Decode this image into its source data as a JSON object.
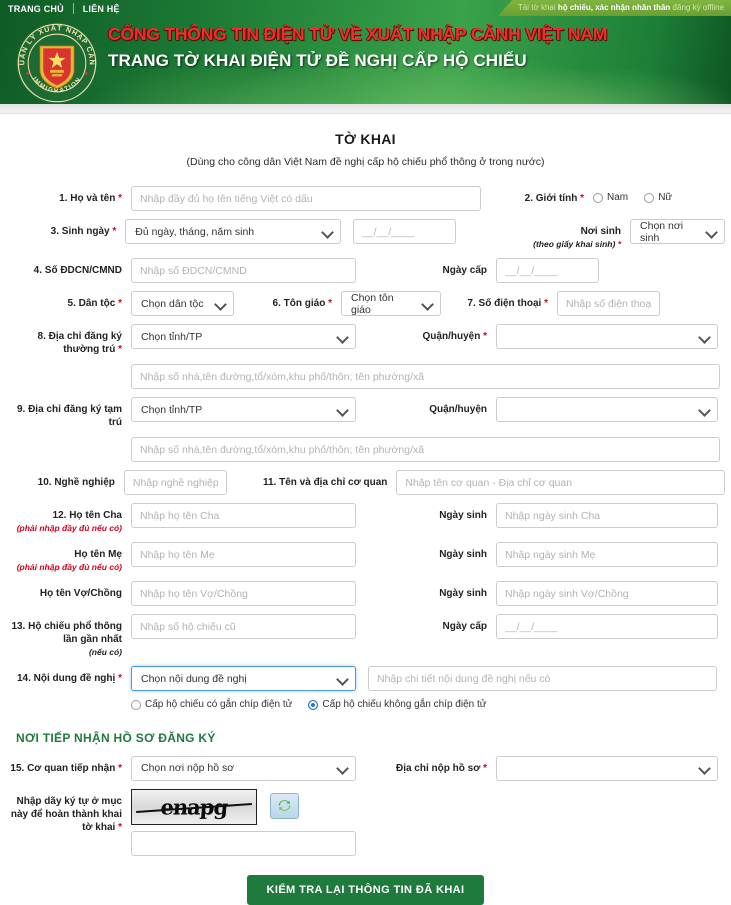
{
  "header": {
    "nav": [
      {
        "label": "TRANG CHỦ"
      },
      {
        "label": "LIÊN HỆ"
      }
    ],
    "notice_pre": "Tải tờ khai ",
    "notice_bold1": "hộ chiếu, xác nhận nhân thân",
    "notice_post": " đăng ký offline",
    "emblem_outer_top": "QUẢN LÝ XUẤT NHẬP CẢNH",
    "emblem_outer_bottom": "IMMIGRATION",
    "title_line1": "CỔNG THÔNG TIN ĐIỆN TỬ VỀ XUẤT NHẬP CẢNH VIỆT NAM",
    "title_line2": "TRANG TỜ KHAI ĐIỆN TỬ ĐỀ NGHỊ CẤP HỘ CHIẾU",
    "colors": {
      "bar_green": "#1d7a36",
      "title_red": "#ef2d2d",
      "notice_green": "#7fb53f"
    }
  },
  "doc": {
    "title": "TỜ KHAI",
    "subtitle": "(Dùng cho công dân Việt Nam đề nghị cấp hộ chiếu phổ thông ở trong nước)"
  },
  "fields": {
    "fullname": {
      "label": "1. Họ và tên",
      "placeholder": "Nhập đầy đủ họ tên tiếng Việt có dấu",
      "value": ""
    },
    "gender": {
      "label": "2. Giới tính",
      "options": [
        {
          "label": "Nam",
          "selected": false
        },
        {
          "label": "Nữ",
          "selected": false
        }
      ]
    },
    "birth": {
      "label": "3. Sinh ngày",
      "select_value": "Đủ ngày, tháng, năm sinh",
      "date_placeholder": "__/__/____",
      "date_value": ""
    },
    "birthplace": {
      "label": "Nơi sinh",
      "sublabel": "(theo giấy khai sinh)",
      "select_value": "Chọn nơi sinh"
    },
    "idcard": {
      "label": "4. Số ĐDCN/CMND",
      "placeholder": "Nhập số ĐDCN/CMND",
      "value": ""
    },
    "idcard_date": {
      "label": "Ngày cấp",
      "placeholder": "__/__/____",
      "value": ""
    },
    "ethnicity": {
      "label": "5. Dân tộc",
      "select_value": "Chọn dân tộc"
    },
    "religion": {
      "label": "6. Tôn giáo",
      "select_value": "Chọn tôn giáo"
    },
    "phone": {
      "label": "7. Số điện thoại",
      "placeholder": "Nhập số điện thoại",
      "value": ""
    },
    "permanent": {
      "label": "8. Địa chỉ đăng ký thường trú",
      "province_value": "Chọn tỉnh/TP",
      "district_label": "Quận/huyện",
      "district_value": "",
      "street_placeholder": "Nhập số nhà,tên đường,tổ/xóm,khu phố/thôn; tên phường/xã",
      "street_value": ""
    },
    "temporary": {
      "label": "9. Địa chỉ đăng ký tạm trú",
      "province_value": "Chọn tỉnh/TP",
      "district_label": "Quận/huyện",
      "district_value": "",
      "street_placeholder": "Nhập số nhà,tên đường,tổ/xóm,khu phố/thôn; tên phường/xã",
      "street_value": ""
    },
    "job": {
      "label": "10. Nghề nghiệp",
      "placeholder": "Nhập nghề nghiệp",
      "value": ""
    },
    "workplace": {
      "label": "11. Tên và địa chỉ cơ quan",
      "placeholder": "Nhập tên cơ quan - Địa chỉ cơ quan",
      "value": ""
    },
    "father": {
      "label": "12. Họ tên Cha",
      "sublabel": "(phải nhập đầy đủ nếu có)",
      "placeholder": "Nhập họ tên Cha",
      "value": "",
      "dob_label": "Ngày sinh",
      "dob_placeholder": "Nhập ngày sinh Cha",
      "dob_value": ""
    },
    "mother": {
      "label": "Họ tên Mẹ",
      "sublabel": "(phải nhập đầy đủ nếu có)",
      "placeholder": "Nhập họ tên Mẹ",
      "value": "",
      "dob_label": "Ngày sinh",
      "dob_placeholder": "Nhập ngày sinh Mẹ",
      "dob_value": ""
    },
    "spouse": {
      "label": "Họ tên Vợ/Chồng",
      "placeholder": "Nhập họ tên Vợ/Chồng",
      "value": "",
      "dob_label": "Ngày sinh",
      "dob_placeholder": "Nhập ngày sinh Vợ/Chồng",
      "dob_value": ""
    },
    "oldpassport": {
      "label": "13. Hộ chiếu phổ thông lần gần nhất",
      "sublabel": "(nếu có)",
      "placeholder": "Nhập số hộ chiếu cũ",
      "value": "",
      "issue_label": "Ngày cấp",
      "issue_placeholder": "__/__/____",
      "issue_value": ""
    },
    "request": {
      "label": "14. Nội dung đề nghị",
      "select_value": "Chọn nội dung đề nghị",
      "detail_placeholder": "Nhập chi tiết nội dung đề nghị nếu có",
      "detail_value": "",
      "options": [
        {
          "label": "Cấp hộ chiếu có gắn chíp điện tử",
          "selected": false
        },
        {
          "label": "Cấp hộ chiếu không gắn chíp điện tử",
          "selected": true
        }
      ]
    }
  },
  "reception": {
    "heading": "NƠI TIẾP NHẬN HỒ SƠ ĐĂNG KÝ",
    "agency": {
      "label": "15. Cơ quan tiếp nhận",
      "select_value": "Chọn nơi nộp hồ sơ"
    },
    "address": {
      "label": "Địa chỉ nộp hồ sơ",
      "select_value": ""
    },
    "captcha": {
      "label": "Nhập dãy ký tự ở mục này để hoàn thành khai tờ khai",
      "image_text": "enapg",
      "refresh_icon": "refresh-icon",
      "input_value": "",
      "input_placeholder": ""
    }
  },
  "submit": {
    "label": "KIỂM TRA LẠI THÔNG TIN ĐÃ KHAI"
  }
}
